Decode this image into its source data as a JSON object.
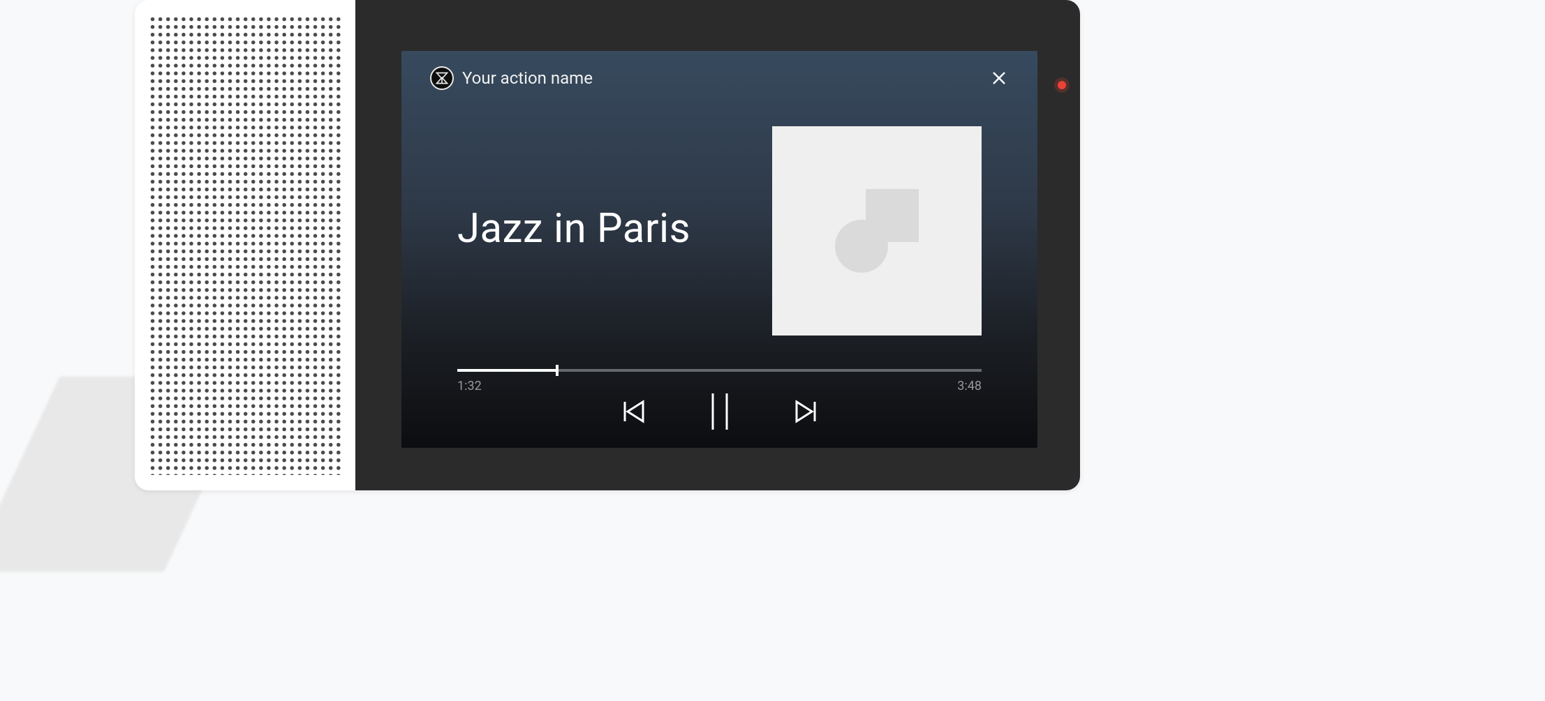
{
  "header": {
    "action_name": "Your action name",
    "app_icon": "hourglass-brand-icon",
    "close_icon": "close-icon"
  },
  "player": {
    "track_title": "Jazz in Paris",
    "album_art_icon": "album-placeholder-icon",
    "elapsed": "1:32",
    "duration": "3:48",
    "progress_percent": 19,
    "controls": {
      "previous_icon": "skip-previous-icon",
      "pause_icon": "pause-icon",
      "next_icon": "skip-next-icon"
    }
  },
  "device": {
    "recording_indicator": true
  },
  "colors": {
    "background": "#f8f9fa",
    "device_frame": "#2b2b2b",
    "card_gradient_top": "#374a5e",
    "card_gradient_bottom": "#0c0d10",
    "accent_recording": "#ea4335"
  }
}
